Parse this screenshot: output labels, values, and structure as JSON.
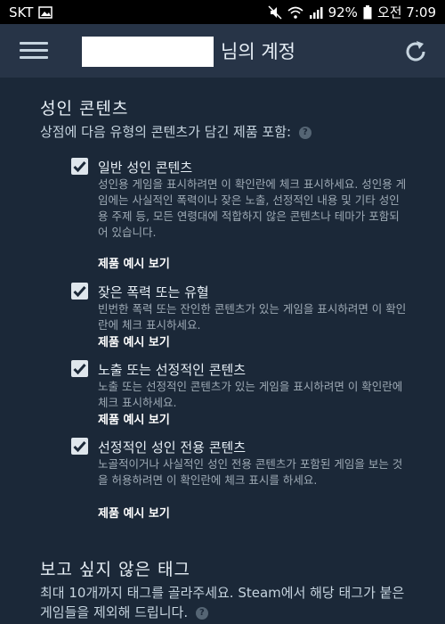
{
  "status_bar": {
    "carrier": "SKT",
    "battery": "92%",
    "time": "오전 7:09"
  },
  "header": {
    "title": "님의 계정"
  },
  "adult_section": {
    "title": "성인 콘텐츠",
    "intro": "상점에 다음 유형의 콘텐츠가 담긴 제품 포함:",
    "options": [
      {
        "label": "일반 성인 콘텐츠",
        "description": "성인용 게임을 표시하려면 이 확인란에 체크 표시하세요. 성인용 게임에는 사실적인 폭력이나 잦은 노출, 선정적인 내용 및 기타 성인용 주제 등, 모든 연령대에 적합하지 않은 콘텐츠나 테마가 포함되어 있습니다.",
        "link": "제품 예시 보기",
        "checked": true
      },
      {
        "label": "잦은 폭력 또는 유혈",
        "description": "빈번한 폭력 또는 잔인한 콘텐츠가 있는 게임을 표시하려면 이 확인란에 체크 표시하세요.",
        "link": "제품 예시 보기",
        "checked": true
      },
      {
        "label": "노출 또는 선정적인 콘텐츠",
        "description": "노출 또는 선정적인 콘텐츠가 있는 게임을 표시하려면 이 확인란에 체크 표시하세요.",
        "link": "제품 예시 보기",
        "checked": true
      },
      {
        "label": "선정적인 성인 전용 콘텐츠",
        "description": "노골적이거나 사실적인 성인 전용 콘텐츠가 포함된 게임을 보는 것을 허용하려면 이 확인란에 체크 표시를 하세요.",
        "link": "제품 예시 보기",
        "checked": true
      }
    ]
  },
  "tags_section": {
    "title": "보고 싶지 않은 태그",
    "intro": "최대 10개까지 태그를 골라주세요. Steam에서 해당 태그가 붙은 게임들을 제외해 드립니다."
  },
  "colors": {
    "background": "#1b2838",
    "app_bar": "#273447",
    "text": "#c6d4df",
    "muted_text": "#9eaab5"
  }
}
